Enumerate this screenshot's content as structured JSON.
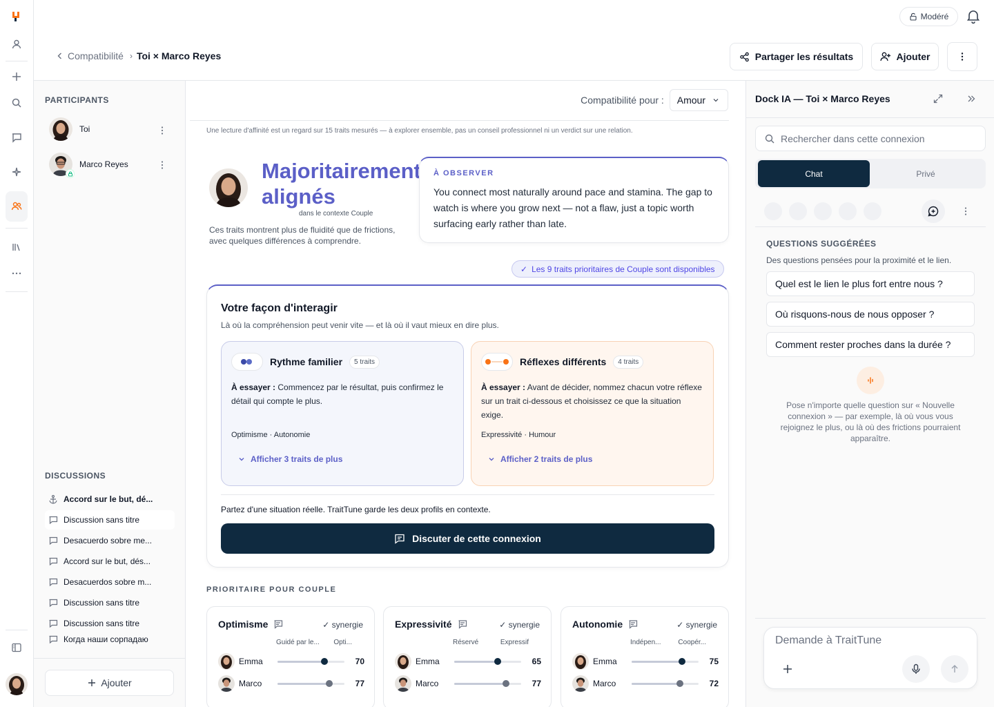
{
  "topbar": {
    "mode_label": "Modéré"
  },
  "breadcrumb": {
    "parent": "Compatibilité",
    "current": "Toi × Marco Reyes"
  },
  "actions": {
    "share": "Partager les résultats",
    "add": "Ajouter"
  },
  "sidebar": {
    "participants_label": "PARTICIPANTS",
    "participants": [
      {
        "name": "Toi"
      },
      {
        "name": "Marco Reyes"
      }
    ],
    "discussions_label": "DISCUSSIONS",
    "discussions": [
      "Accord sur le but, dé...",
      "Discussion sans titre",
      "Desacuerdo sobre me...",
      "Accord sur le but, dés...",
      "Desacuerdos sobre m...",
      "Discussion sans titre",
      "Discussion sans titre",
      "Когда наши сорпадаю"
    ],
    "add_label": "Ajouter"
  },
  "main": {
    "compat_label": "Compatibilité pour :",
    "compat_value": "Amour",
    "disclaimer": "Une lecture d'affinité est un regard sur 15 traits mesurés — à explorer ensemble, pas un conseil professionnel ni un verdict sur une relation.",
    "hero_title": "Majoritairement alignés",
    "hero_context": "dans le contexte Couple",
    "hero_desc": "Ces traits montrent plus de fluidité que de frictions, avec quelques différences à comprendre.",
    "observe_label": "À OBSERVER",
    "observe_text": "You connect most naturally around pace and stamina. The gap to watch is where you grow next — not a flaw, just a topic worth surfacing early rather than late.",
    "badge": "Les 9 traits prioritaires de Couple sont disponibles",
    "interact_title": "Votre façon d'interagir",
    "interact_sub": "Là où la compréhension peut venir vite — et là où il vaut mieux en dire plus.",
    "cards": [
      {
        "title": "Rythme familier",
        "count": "5 traits",
        "try_label": "À essayer :",
        "try_text": "Commencez par le résultat, puis confirmez le détail qui compte le plus.",
        "traits": "Optimisme · Autonomie",
        "more": "Afficher 3 traits de plus"
      },
      {
        "title": "Réflexes différents",
        "count": "4 traits",
        "try_label": "À essayer :",
        "try_text": "Avant de décider, nommez chacun votre réflexe sur un trait ci-dessous et choisissez ce que la situation exige.",
        "traits": "Expressivité · Humour",
        "more": "Afficher 2 traits de plus"
      }
    ],
    "situation_text": "Partez d'une situation réelle. TraitTune garde les deux profils en contexte.",
    "discuss_label": "Discuter de cette connexion",
    "priority_label": "PRIORITAIRE POUR COUPLE",
    "priority": [
      {
        "name": "Optimisme",
        "synergy": "✓ synergie",
        "left": "Guidé par le...",
        "right": "Opti...",
        "p1": "Emma",
        "v1": 70,
        "p2": "Marco",
        "v2": 77
      },
      {
        "name": "Expressivité",
        "synergy": "✓ synergie",
        "left": "Réservé",
        "right": "Expressif",
        "p1": "Emma",
        "v1": 65,
        "p2": "Marco",
        "v2": 77
      },
      {
        "name": "Autonomie",
        "synergy": "✓ synergie",
        "left": "Indépen...",
        "right": "Coopér...",
        "p1": "Emma",
        "v1": 75,
        "p2": "Marco",
        "v2": 72
      }
    ]
  },
  "dock": {
    "title": "Dock IA — Toi × Marco Reyes",
    "search_placeholder": "Rechercher dans cette connexion",
    "tabs": [
      "Chat",
      "Privé"
    ],
    "suggested_label": "QUESTIONS SUGGÉRÉES",
    "suggested_sub": "Des questions pensées pour la proximité et le lien.",
    "questions": [
      "Quel est le lien le plus fort entre nous ?",
      "Où risquons-nous de nous opposer ?",
      "Comment rester proches dans la durée ?"
    ],
    "hint": "Pose n'importe quelle question sur « Nouvelle connexion » — par exemple, là où vous vous rejoignez le plus, ou là où des frictions pourraient apparaître.",
    "ask_placeholder": "Demande à TraitTune"
  },
  "colors": {
    "accent": "#5b5fc7",
    "navy": "#0f2a40",
    "orange": "#f97316",
    "emma_knob": "#0f2a40",
    "marco_knob": "#6b7280"
  }
}
